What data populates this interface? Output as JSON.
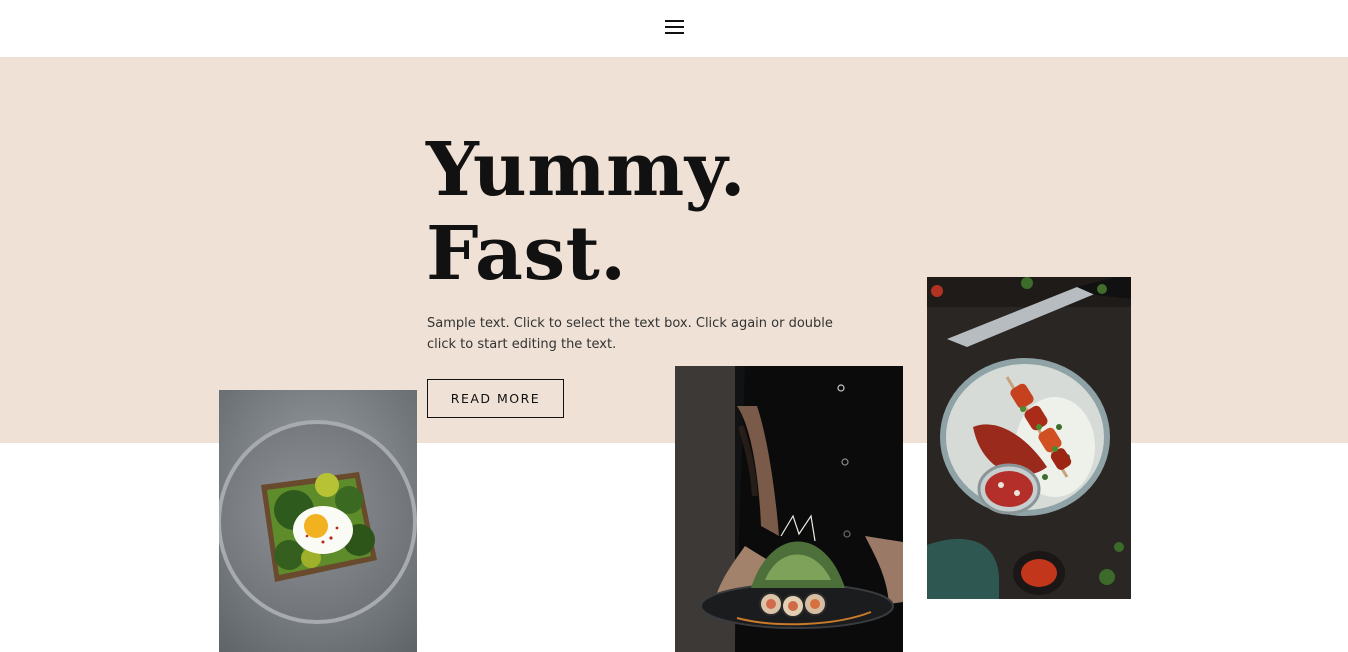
{
  "colors": {
    "hero_background": "#efe1d5",
    "text_primary": "#111111",
    "text_secondary": "#333333"
  },
  "header": {
    "menu_icon": "hamburger-menu-icon"
  },
  "hero": {
    "headline_line1": "Yummy.",
    "headline_line2": "Fast.",
    "body": "Sample text. Click to select the text box. Click again or double click to start editing the text.",
    "button_label": "READ MORE"
  },
  "images": [
    {
      "subject": "avocado-toast-with-poached-egg"
    },
    {
      "subject": "chef-plating-sushi-rolls"
    },
    {
      "subject": "grilled-skewers-with-rice-and-knife"
    }
  ]
}
